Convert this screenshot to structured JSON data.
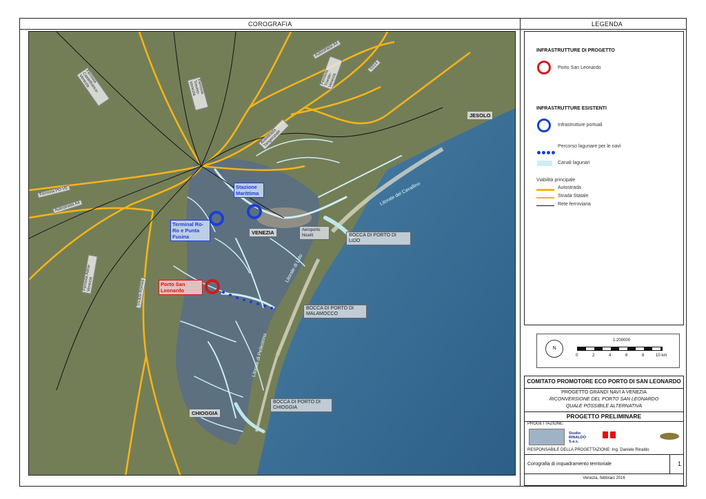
{
  "header": {
    "map_title": "COROGRAFIA",
    "legend_title": "LEGENDA"
  },
  "map_labels": {
    "jesolo": "JESOLO",
    "venezia": "VENEZIA",
    "chioggia": "CHIOGGIA",
    "stazione_marittima": "Stazione Marittima",
    "terminal_roro": "Terminal Ro-Ro e Punta Fusina",
    "porto_san_leonardo": "Porto San Leonardo",
    "bocca_lido": "BOCCA DI PORTO DI LIDO",
    "bocca_malamocco": "BOCCA DI PORTO DI MALAMOCCO",
    "bocca_chioggia": "BOCCA DI PORTO DI CHIOGGIA",
    "aeroporto": "Aeroporto Nicelli",
    "litorale_cavallino": "Litorale del Cavallino",
    "litorale_lido": "Litorale di Lido",
    "litorale_pellestrina": "Litorale di Pellestrina",
    "road_a4": "Autostrada A4",
    "road_a4_left": "Autostrada A4",
    "road_a57": "Ferrovia PD-VE",
    "road_ss14": "SS14",
    "road_mestre": "Ferrovia Trieste-Venezia",
    "road_castelfranco": "Ferrovia Castelfranco-Venezia",
    "road_treviso": "Ferrovia Treviso-Venezia",
    "road_adria": "Ferrovia Adria-Venezia",
    "road_romea": "SS309 Romea",
    "road_tangenziale": "Autostrada Tangenziale"
  },
  "legend": {
    "progetto_title": "INFRASTRUTTURE DI PROGETTO",
    "porto_san_leonardo": "Porto San Leonardo",
    "esistenti_title": "INFRASTRUTTURE ESISTENTI",
    "infrastrutture_portuali": "Infrastrutture portuali",
    "percorso": "Percorso lagunare per le navi",
    "canali": "Canali lagunari",
    "viabilita": "Viabilità principale",
    "autostrada": "Autostrada",
    "strada_statale": "Strada Statale",
    "rete_ferroviaria": "Rete ferroviaria",
    "colors": {
      "red": "#d11a1a",
      "blue": "#1a3fd6",
      "yellow": "#f4b41a",
      "rail": "#111111",
      "canal": "#cdeef5"
    }
  },
  "scale": {
    "ratio": "1:200000",
    "ticks": [
      "0",
      "2",
      "4",
      "6",
      "8",
      "10 km"
    ],
    "north": "N"
  },
  "title_block": {
    "committee": "COMITATO PROMOTORE ECO PORTO DI SAN LEONARDO",
    "project_line1": "PROGETTO GRANDI NAVI A VENEZIA",
    "project_line2": "RICONVERSIONE DEL PORTO SAN LEONARDO",
    "project_line3": "QUALE POSSIBILE ALTERNATIVA",
    "phase": "PROGETTO PRELIMINARE",
    "progettazione": "PROGETTAZIONE:",
    "studio": "Studio RINALDO S.a.s.",
    "responsabile": "RESPONSABILE DELLA PROGETTAZIONE: Ing. Daniele Rinaldo",
    "drawing_title": "Corografia di inquadramento territoriale",
    "sheet": "1",
    "date": "Venezia, febbraio 2016"
  }
}
